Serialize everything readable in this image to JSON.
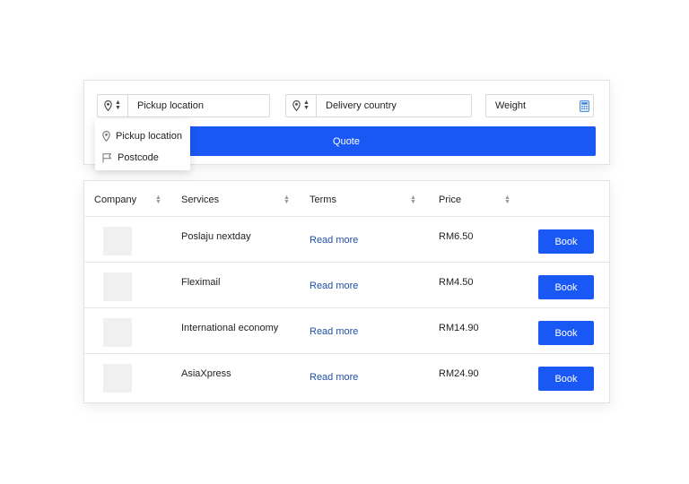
{
  "search": {
    "pickup_placeholder": "Pickup location",
    "delivery_placeholder": "Delivery country",
    "weight_placeholder": "Weight",
    "quote_label": "Quote"
  },
  "dropdown": {
    "items": [
      {
        "label": "Pickup location",
        "icon": "pin-icon"
      },
      {
        "label": "Postcode",
        "icon": "flag-icon"
      }
    ]
  },
  "table": {
    "headers": [
      "Company",
      "Services",
      "Terms",
      "Price"
    ],
    "rows": [
      {
        "service": "Poslaju nextday",
        "terms": "Read more",
        "price": "RM6.50",
        "action": "Book"
      },
      {
        "service": "Fleximail",
        "terms": "Read more",
        "price": "RM4.50",
        "action": "Book"
      },
      {
        "service": "International economy",
        "terms": "Read more",
        "price": "RM14.90",
        "action": "Book"
      },
      {
        "service": "AsiaXpress",
        "terms": "Read more",
        "price": "RM24.90",
        "action": "Book"
      }
    ]
  },
  "colors": {
    "accent": "#1a58f5",
    "link": "#1f4fa3"
  }
}
